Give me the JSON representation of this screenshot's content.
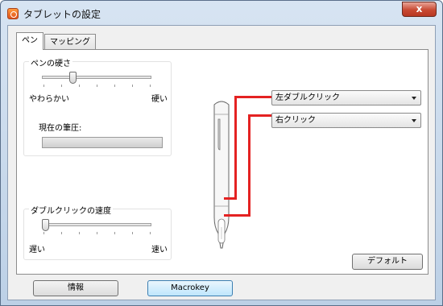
{
  "window": {
    "title": "タブレットの設定",
    "close_label": "x"
  },
  "tabs": [
    {
      "label": "ペン",
      "active": true
    },
    {
      "label": "マッピング",
      "active": false
    }
  ],
  "pen_hardness": {
    "label": "ペンの硬さ",
    "min_label": "やわらかい",
    "max_label": "硬い",
    "value_fraction": 0.27,
    "pressure_label": "現在の筆圧:"
  },
  "double_click_speed": {
    "label": "ダブルクリックの速度",
    "min_label": "遅い",
    "max_label": "速い",
    "value_fraction": 0.0
  },
  "pen_buttons": {
    "upper_select": "左ダブルクリック",
    "lower_select": "右クリック"
  },
  "buttons": {
    "default": "デフォルト",
    "info": "情報",
    "macrokey": "Macrokey"
  },
  "colors": {
    "callout_line": "#e42222",
    "window_frame": "#bcd0e6"
  }
}
